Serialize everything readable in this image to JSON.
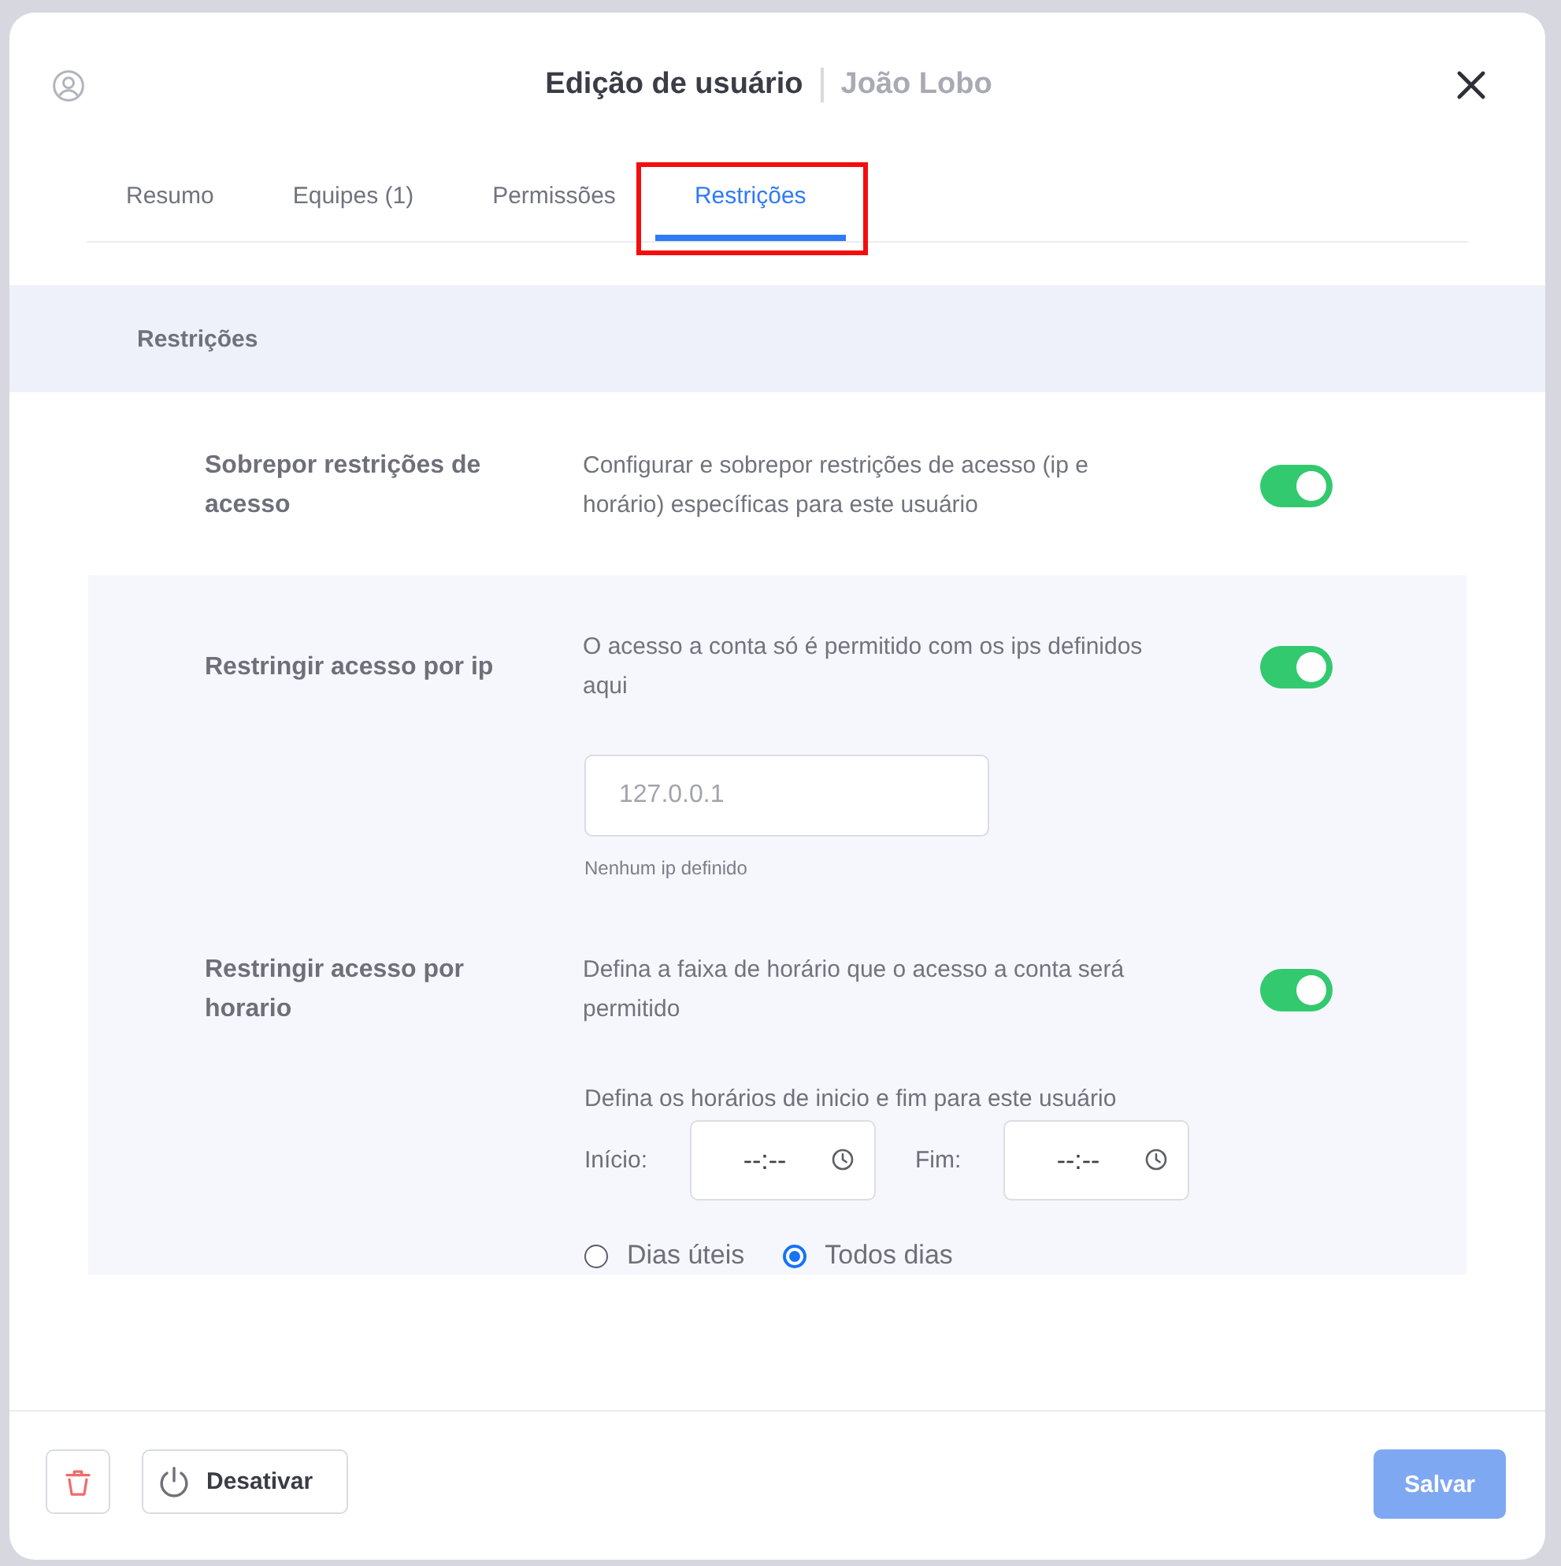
{
  "header": {
    "title": "Edição de usuário",
    "subtitle": "João Lobo"
  },
  "tabs": [
    {
      "label": "Resumo",
      "selected": false,
      "highlighted": false
    },
    {
      "label": "Equipes (1)",
      "selected": false,
      "highlighted": false
    },
    {
      "label": "Permissões",
      "selected": false,
      "highlighted": false
    },
    {
      "label": "Restrições",
      "selected": true,
      "highlighted": true
    }
  ],
  "section": {
    "title": "Restrições"
  },
  "override": {
    "label": "Sobrepor restrições de acesso",
    "description": "Configurar e sobrepor restrições de acesso (ip e horário) específicas para este usuário",
    "on": true
  },
  "restrictions": [
    {
      "kind": "ip",
      "label": "Restringir acesso por ip",
      "description": "O acesso a conta só é permitido com os ips definidos aqui",
      "on": true,
      "input": {
        "placeholder": "127.0.0.1"
      },
      "hint": "Nenhum ip definido"
    },
    {
      "kind": "schedule",
      "label": "Restringir acesso por horario",
      "description": "Defina a faixa de horário que o acesso a conta será permitido",
      "on": true,
      "instruction": "Defina os horários de inicio e fim para este usuário",
      "times": [
        {
          "label": "Início:",
          "placeholder": "--:--"
        },
        {
          "label": "Fim:",
          "placeholder": "--:--"
        }
      ],
      "days": [
        {
          "label": "Dias úteis",
          "selected": false
        },
        {
          "label": "Todos dias",
          "selected": true
        }
      ]
    }
  ],
  "footer": {
    "deactivate_button": {
      "label": "Desativar"
    },
    "save_button": {
      "label": "Salvar",
      "disabled": true
    }
  }
}
